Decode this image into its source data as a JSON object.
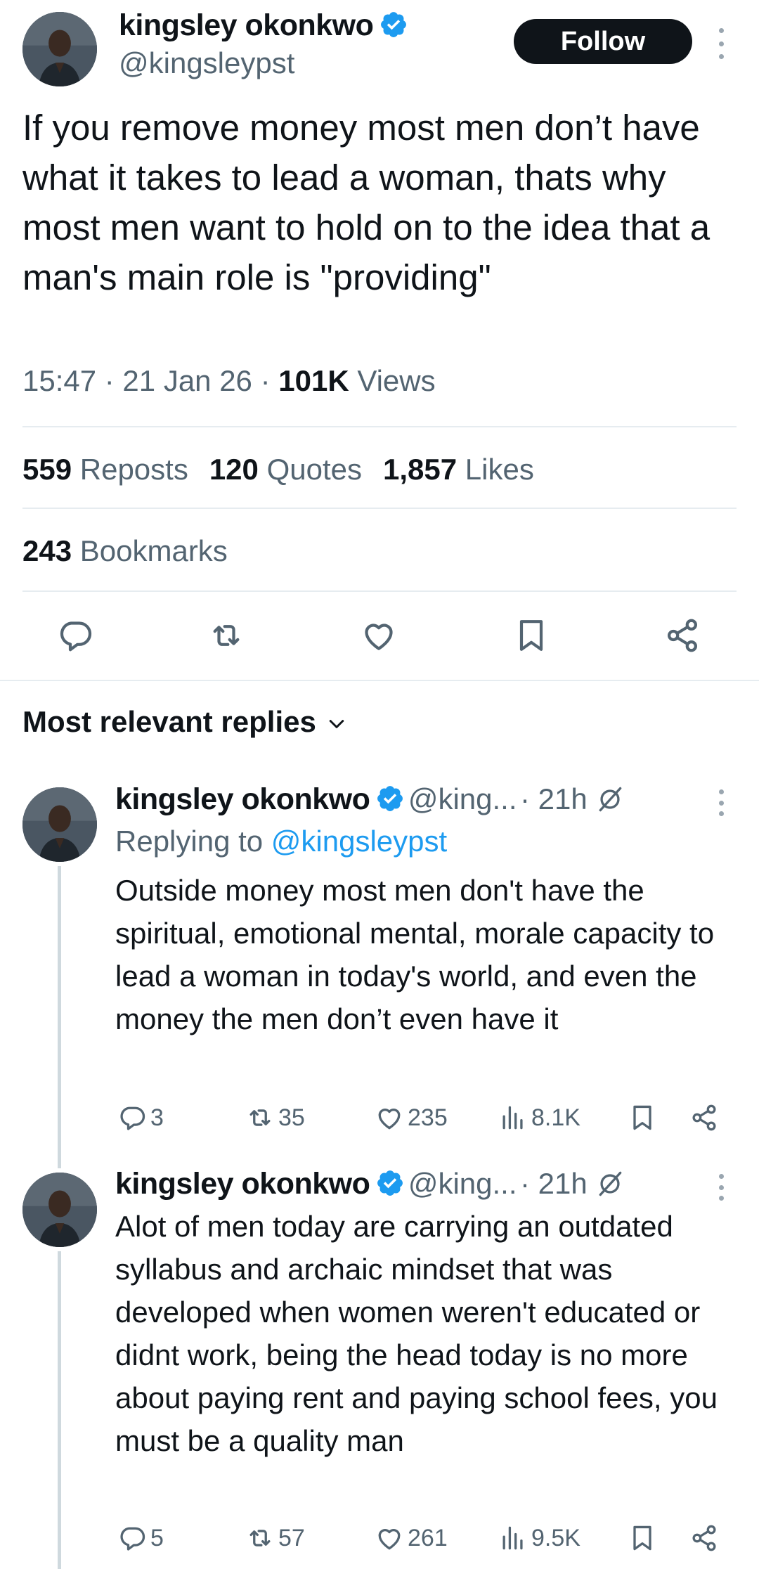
{
  "post": {
    "author_name": "kingsley okonkwo",
    "author_handle": "@kingsleypst",
    "follow_label": "Follow",
    "text": "If you remove money most men don’t have what it takes to lead a woman, thats why most men want to hold on to the idea that a man's main role is \"providing\"",
    "time": "15:47 · 21 Jan 26 · ",
    "views_count": "101K",
    "views_label": " Views",
    "stats": {
      "reposts_count": "559",
      "reposts_label": "Reposts",
      "quotes_count": "120",
      "quotes_label": "Quotes",
      "likes_count": "1,857",
      "likes_label": "Likes",
      "bookmarks_count": "243",
      "bookmarks_label": "Bookmarks"
    }
  },
  "replies_section": {
    "title": "Most relevant replies"
  },
  "replies": [
    {
      "author_name": "kingsley okonkwo",
      "author_handle": "@king...",
      "age": "· 21h",
      "replying_prefix": "Replying to ",
      "replying_to": "@kingsleypst",
      "text": "Outside money most men don't have the spiritual, emotional mental, morale capacity to lead a woman in today's world, and even the money the men don’t even have it",
      "replies": "3",
      "reposts": "35",
      "likes": "235",
      "views": "8.1K"
    },
    {
      "author_name": "kingsley okonkwo",
      "author_handle": "@king...",
      "age": "· 21h",
      "text": "Alot of men today are carrying an outdated syllabus and archaic mindset that was developed when women weren't educated or didnt work, being the head today is no more about paying rent and paying school fees, you must be a quality man",
      "replies": "5",
      "reposts": "57",
      "likes": "261",
      "views": "9.5K"
    }
  ],
  "colors": {
    "accent": "#1d9bf0",
    "text": "#0f1419",
    "secondary": "#536471",
    "divider": "#e6ecf0"
  },
  "icons": [
    "verified-badge-icon",
    "more-icon",
    "reply-icon",
    "repost-icon",
    "like-icon",
    "bookmark-icon",
    "share-icon",
    "chevron-down-icon",
    "mute-icon",
    "views-icon"
  ]
}
